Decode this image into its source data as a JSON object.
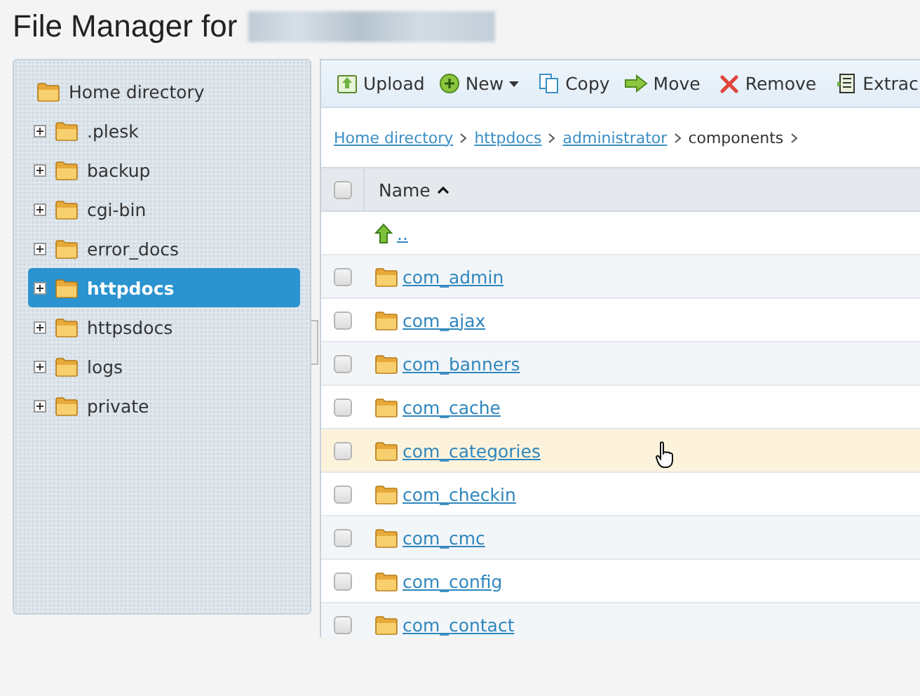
{
  "page": {
    "title": "File Manager for"
  },
  "tree": {
    "label": "Home directory",
    "children": [
      {
        "label": ".plesk",
        "expanded": false,
        "selected": false
      },
      {
        "label": "backup",
        "expanded": false,
        "selected": false
      },
      {
        "label": "cgi-bin",
        "expanded": false,
        "selected": false
      },
      {
        "label": "error_docs",
        "expanded": false,
        "selected": false
      },
      {
        "label": "httpdocs",
        "expanded": false,
        "selected": true
      },
      {
        "label": "httpsdocs",
        "expanded": false,
        "selected": false
      },
      {
        "label": "logs",
        "expanded": false,
        "selected": false
      },
      {
        "label": "private",
        "expanded": false,
        "selected": false
      }
    ]
  },
  "toolbar": [
    {
      "kind": "upload",
      "label": "Upload"
    },
    {
      "kind": "new",
      "label": "New",
      "dropdown": true
    },
    {
      "kind": "copy",
      "label": "Copy"
    },
    {
      "kind": "move",
      "label": "Move"
    },
    {
      "kind": "remove",
      "label": "Remove"
    },
    {
      "kind": "extract",
      "label": "Extrac"
    }
  ],
  "breadcrumb": [
    {
      "label": "Home directory",
      "link": true
    },
    {
      "label": "httpdocs",
      "link": true
    },
    {
      "label": "administrator",
      "link": true
    },
    {
      "label": "components",
      "link": false
    }
  ],
  "table": {
    "select_all": {
      "checked": false
    },
    "columns": [
      {
        "label": "Name",
        "sorted": true
      }
    ],
    "rows": [
      {
        "kind": "parent",
        "name": "..",
        "highlighted": false
      },
      {
        "kind": "folder",
        "name": "com_admin",
        "checked": false,
        "highlighted": false
      },
      {
        "kind": "folder",
        "name": "com_ajax",
        "checked": false,
        "highlighted": false
      },
      {
        "kind": "folder",
        "name": "com_banners",
        "checked": false,
        "highlighted": false
      },
      {
        "kind": "folder",
        "name": "com_cache",
        "checked": false,
        "highlighted": false
      },
      {
        "kind": "folder",
        "name": "com_categories",
        "checked": false,
        "highlighted": true
      },
      {
        "kind": "folder",
        "name": "com_checkin",
        "checked": false,
        "highlighted": false
      },
      {
        "kind": "folder",
        "name": "com_cmc",
        "checked": false,
        "highlighted": false
      },
      {
        "kind": "folder",
        "name": "com_config",
        "checked": false,
        "highlighted": false
      },
      {
        "kind": "folder",
        "name": "com_contact",
        "checked": false,
        "highlighted": false
      }
    ]
  }
}
